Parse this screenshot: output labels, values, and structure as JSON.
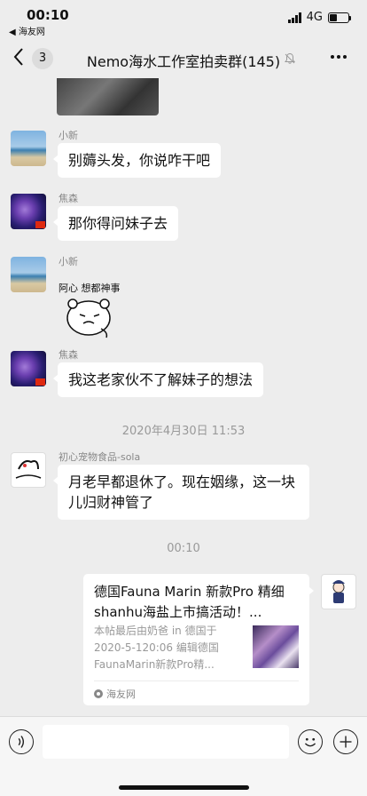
{
  "status": {
    "time": "00:10",
    "back_app": "◀ 海友网",
    "network": "4G",
    "battery_level": 0.4
  },
  "nav": {
    "back_count": "3",
    "title": "Nemo海水工作室拍卖群(145)",
    "muted": true
  },
  "messages": [
    {
      "sender": "小新",
      "text": "别薅头发，你说咋干吧"
    },
    {
      "sender": "焦森",
      "text": "那你得问妹子去"
    },
    {
      "sender": "小新",
      "sticker_text": "阿心 想都神事"
    },
    {
      "sender": "焦森",
      "text": "我这老家伙不了解妹子的想法"
    },
    {
      "timestamp": "2020年4月30日 11:53"
    },
    {
      "sender": "初心宠物食品-sola",
      "text": "月老早都退休了。现在姻缘，这一块儿归财神管了"
    },
    {
      "timestamp": "00:10"
    }
  ],
  "link_card": {
    "title": "德国Fauna Marin 新款Pro 精细shanhu海盐上市搞活动！...",
    "description": "本帖最后由奶爸 in 德国于 2020-5-120:06 编辑德国FaunaMarin新款Pro精...",
    "source": "海友网"
  },
  "icons": {
    "back": "chevron-left-icon",
    "mute": "bell-slash-icon",
    "more": "more-dots-icon",
    "voice": "voice-icon",
    "emoji": "emoji-icon",
    "plus": "plus-icon"
  }
}
